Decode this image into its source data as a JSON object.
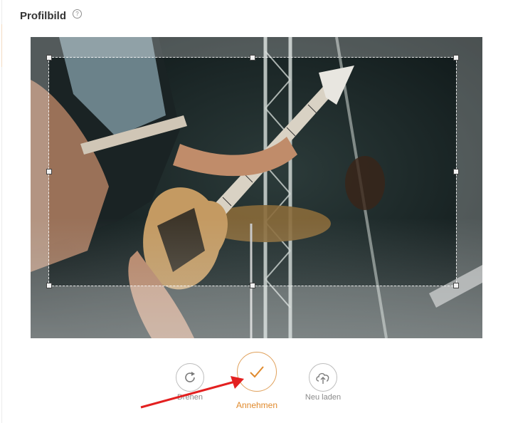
{
  "section": {
    "title": "Profilbild",
    "help_icon": "question-circle-icon",
    "help_glyph": "?"
  },
  "editor": {
    "image_alt": "Bassist und Gitarrist bei einem Konzert"
  },
  "actions": [
    {
      "id": "rotate",
      "label": "Drehen",
      "icon": "rotate-icon"
    },
    {
      "id": "accept",
      "label": "Annehmen",
      "icon": "checkmark-icon"
    },
    {
      "id": "reload",
      "label": "Neu laden",
      "icon": "cloud-upload-icon"
    }
  ],
  "colors": {
    "accent": "#e08a2d",
    "annotation_arrow": "#e32020",
    "muted": "#8a8a8a"
  }
}
